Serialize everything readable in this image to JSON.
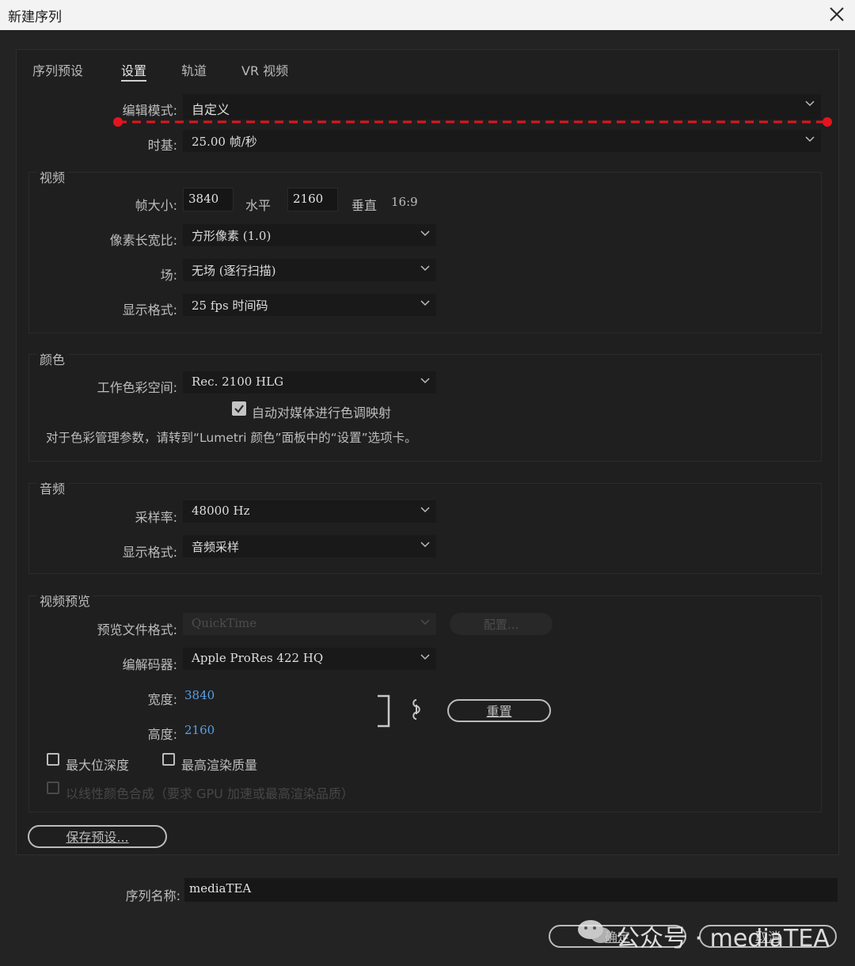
{
  "window": {
    "title": "新建序列"
  },
  "tabs": [
    {
      "label": "序列预设"
    },
    {
      "label": "设置"
    },
    {
      "label": "轨道"
    },
    {
      "label": "VR 视频"
    }
  ],
  "general": {
    "editing_mode_label": "编辑模式:",
    "editing_mode_value": "自定义",
    "timebase_label": "时基:",
    "timebase_value": "25.00  帧/秒"
  },
  "video": {
    "group_title": "视频",
    "frame_size_label": "帧大小:",
    "frame_width": "3840",
    "horizontal_label": "水平",
    "frame_height": "2160",
    "vertical_label": "垂直",
    "aspect": "16:9",
    "pixel_aspect_label": "像素长宽比:",
    "pixel_aspect_value": "方形像素 (1.0)",
    "fields_label": "场:",
    "fields_value": "无场 (逐行扫描)",
    "display_format_label": "显示格式:",
    "display_format_value": "25 fps 时间码"
  },
  "color": {
    "group_title": "颜色",
    "working_space_label": "工作色彩空间:",
    "working_space_value": "Rec. 2100 HLG",
    "auto_tone_map_label": "自动对媒体进行色调映射",
    "auto_tone_map_checked": true,
    "note": "对于色彩管理参数，请转到“Lumetri 颜色”面板中的“设置”选项卡。"
  },
  "audio": {
    "group_title": "音频",
    "sample_rate_label": "采样率:",
    "sample_rate_value": "48000 Hz",
    "display_format_label": "显示格式:",
    "display_format_value": "音频采样"
  },
  "preview": {
    "group_title": "视频预览",
    "file_format_label": "预览文件格式:",
    "file_format_value": "QuickTime",
    "configure_label": "配置...",
    "codec_label": "编解码器:",
    "codec_value": "Apple ProRes 422 HQ",
    "width_label": "宽度:",
    "width_value": "3840",
    "height_label": "高度:",
    "height_value": "2160",
    "reset_label": "重置",
    "max_bit_depth_label": "最大位深度",
    "max_render_quality_label": "最高渲染质量",
    "linear_color_label": "以线性颜色合成（要求 GPU 加速或最高渲染品质）"
  },
  "save_preset_label": "保存预设...",
  "sequence_name_label": "序列名称:",
  "sequence_name_value": "mediaTEA",
  "ok_label": "确定",
  "cancel_label": "取消",
  "watermark": "公众号 · mediaTEA"
}
